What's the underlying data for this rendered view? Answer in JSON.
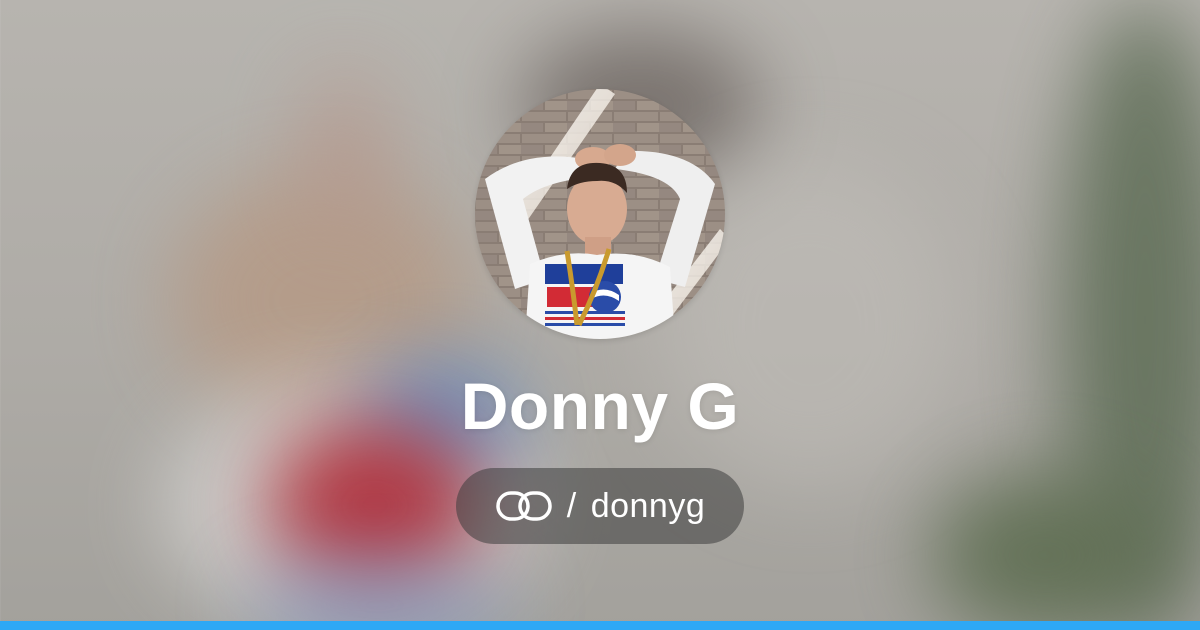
{
  "profile": {
    "display_name": "Donny G",
    "handle_separator": "/",
    "handle": "donnyg"
  },
  "icons": {
    "brand_logo": "linked-rings-logo-icon",
    "avatar": "profile-photo"
  },
  "colors": {
    "accent_bar": "#2ea8f5",
    "text": "#ffffff",
    "pill_background": "rgba(60,60,60,0.55)"
  }
}
